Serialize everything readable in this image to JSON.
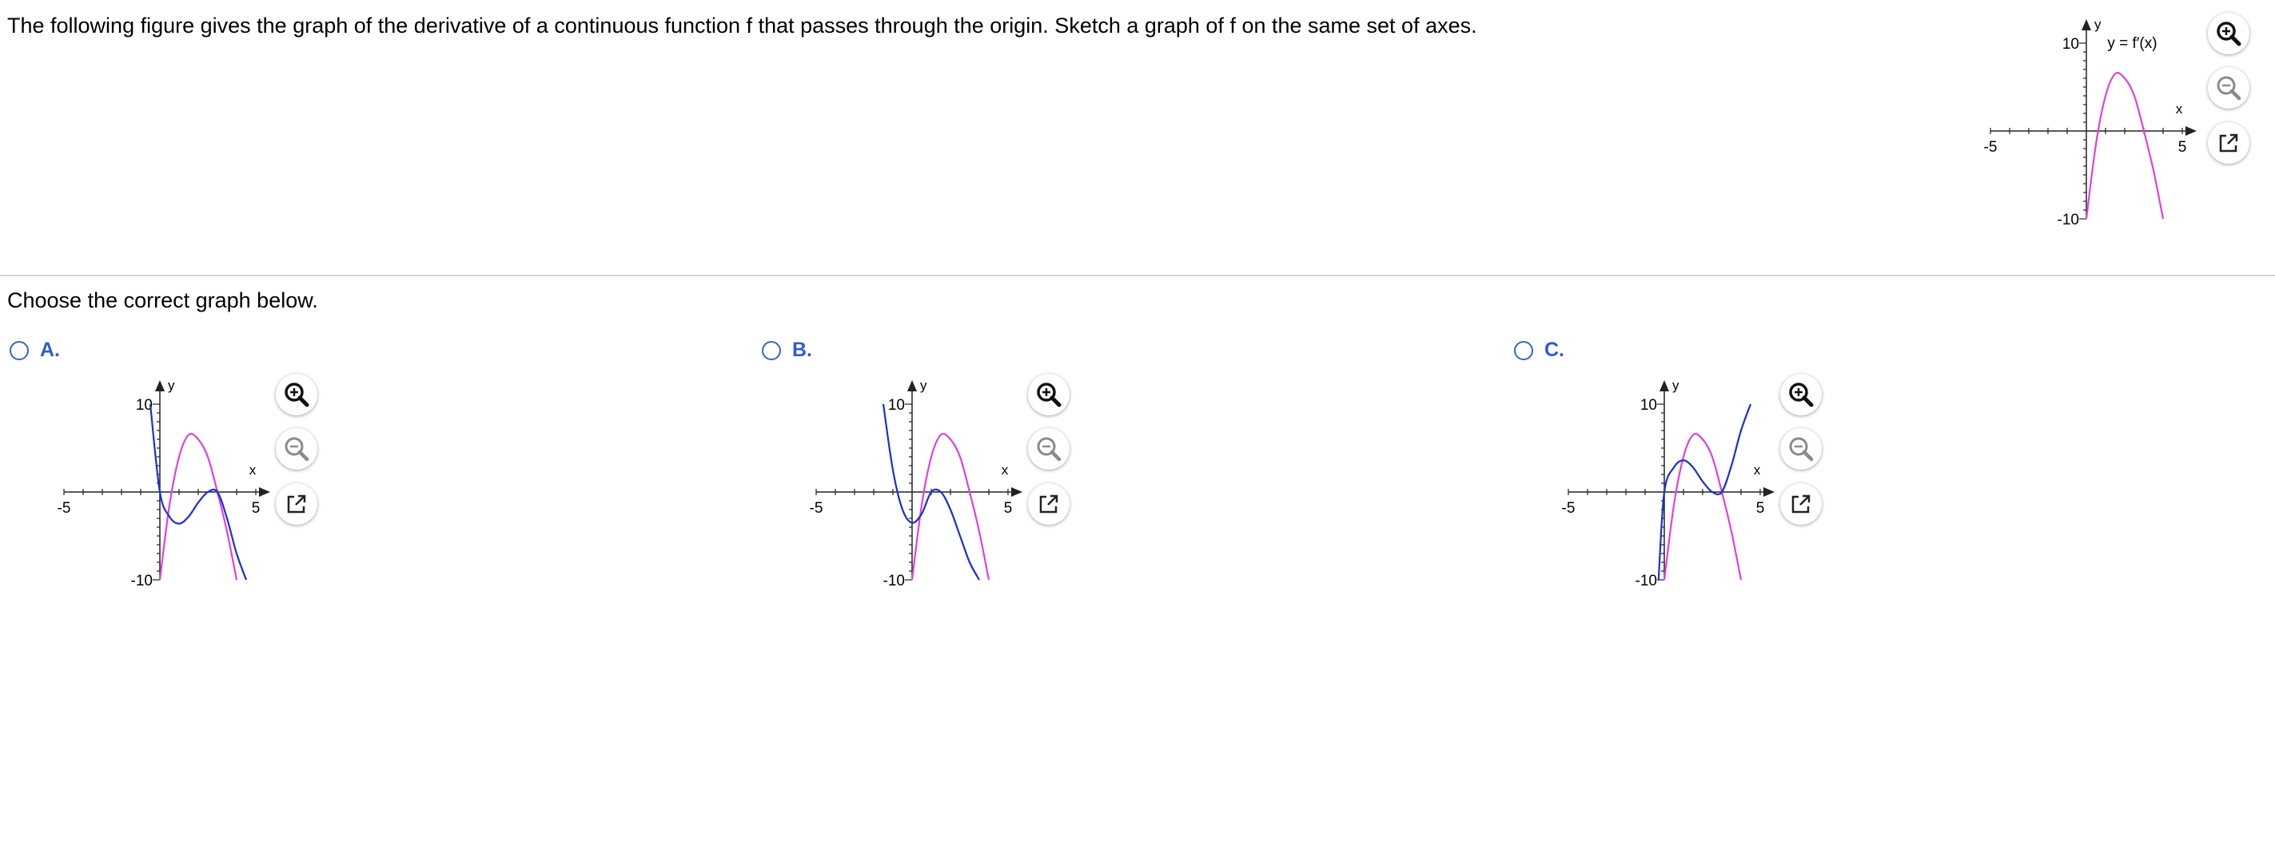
{
  "question": "The following figure gives the graph of the derivative of a continuous function f that passes through the origin. Sketch a graph of f on the same set of axes.",
  "prompt": "Choose the correct graph below.",
  "axis": {
    "x_label": "x",
    "y_label": "y",
    "xmin_label": "-5",
    "xmax_label": "5",
    "ymax_label": "10",
    "ymin_label": "-10"
  },
  "reference_graph": {
    "curve_label": "y = f′(x)"
  },
  "options": [
    {
      "letter": "A."
    },
    {
      "letter": "B."
    },
    {
      "letter": "C."
    }
  ],
  "tools": {
    "zoom_in": "zoom-in-icon",
    "zoom_out": "zoom-out-icon",
    "open_new_window": "open-external-icon"
  },
  "colors": {
    "derivative": "#e040e0",
    "function": "#1a2fd6",
    "radio": "#3465d0",
    "option_label": "#2d5bd6",
    "divider": "#d0d4da"
  },
  "chart_data": [
    {
      "type": "line",
      "xlim": [
        -5,
        5
      ],
      "ylim": [
        -10,
        10
      ],
      "series": [
        {
          "name": "y = f′(x)",
          "x": [
            0,
            0.5,
            1,
            1.5,
            2,
            2.5,
            3,
            3.5,
            4
          ],
          "y": [
            -10,
            -1.5,
            4,
            6.5,
            6,
            4,
            0,
            -4.5,
            -10
          ]
        }
      ]
    },
    {
      "type": "line",
      "xlim": [
        -5,
        5
      ],
      "ylim": [
        -10,
        10
      ],
      "series": [
        {
          "x": [
            0,
            0.5,
            1,
            1.5,
            2,
            2.5,
            3,
            3.5,
            4
          ],
          "y": [
            -10,
            -1.5,
            4,
            6.5,
            6,
            4,
            0,
            -4.5,
            -10
          ]
        },
        {
          "x": [
            -0.5,
            0,
            0.5,
            1,
            1.5,
            2,
            2.5,
            3,
            3.5,
            4,
            4.5
          ],
          "y": [
            10,
            0,
            -2.8,
            -3.6,
            -2.8,
            -1.2,
            0,
            0,
            -3,
            -7,
            -10
          ]
        }
      ]
    },
    {
      "type": "line",
      "xlim": [
        -5,
        5
      ],
      "ylim": [
        -10,
        10
      ],
      "series": [
        {
          "x": [
            0,
            0.5,
            1,
            1.5,
            2,
            2.5,
            3,
            3.5,
            4
          ],
          "y": [
            -10,
            -1.5,
            4,
            6.5,
            6,
            4,
            0,
            -4.5,
            -10
          ]
        },
        {
          "x": [
            -1.5,
            -1,
            -0.5,
            0,
            0.5,
            1,
            1.5,
            2,
            2.5,
            3,
            3.5
          ],
          "y": [
            10,
            2.5,
            -2,
            -3.5,
            -2.5,
            0,
            0,
            -2,
            -5,
            -8,
            -10
          ]
        }
      ]
    },
    {
      "type": "line",
      "xlim": [
        -5,
        5
      ],
      "ylim": [
        -10,
        10
      ],
      "series": [
        {
          "x": [
            0,
            0.5,
            1,
            1.5,
            2,
            2.5,
            3,
            3.5,
            4
          ],
          "y": [
            -10,
            -1.5,
            4,
            6.5,
            6,
            4,
            0,
            -4.5,
            -10
          ]
        },
        {
          "x": [
            -0.3,
            0,
            0.5,
            1,
            1.5,
            2,
            2.5,
            3,
            3.5,
            4,
            4.5
          ],
          "y": [
            -10,
            0,
            2.8,
            3.6,
            2.8,
            1.2,
            0,
            0,
            3,
            7,
            10
          ]
        }
      ]
    }
  ]
}
